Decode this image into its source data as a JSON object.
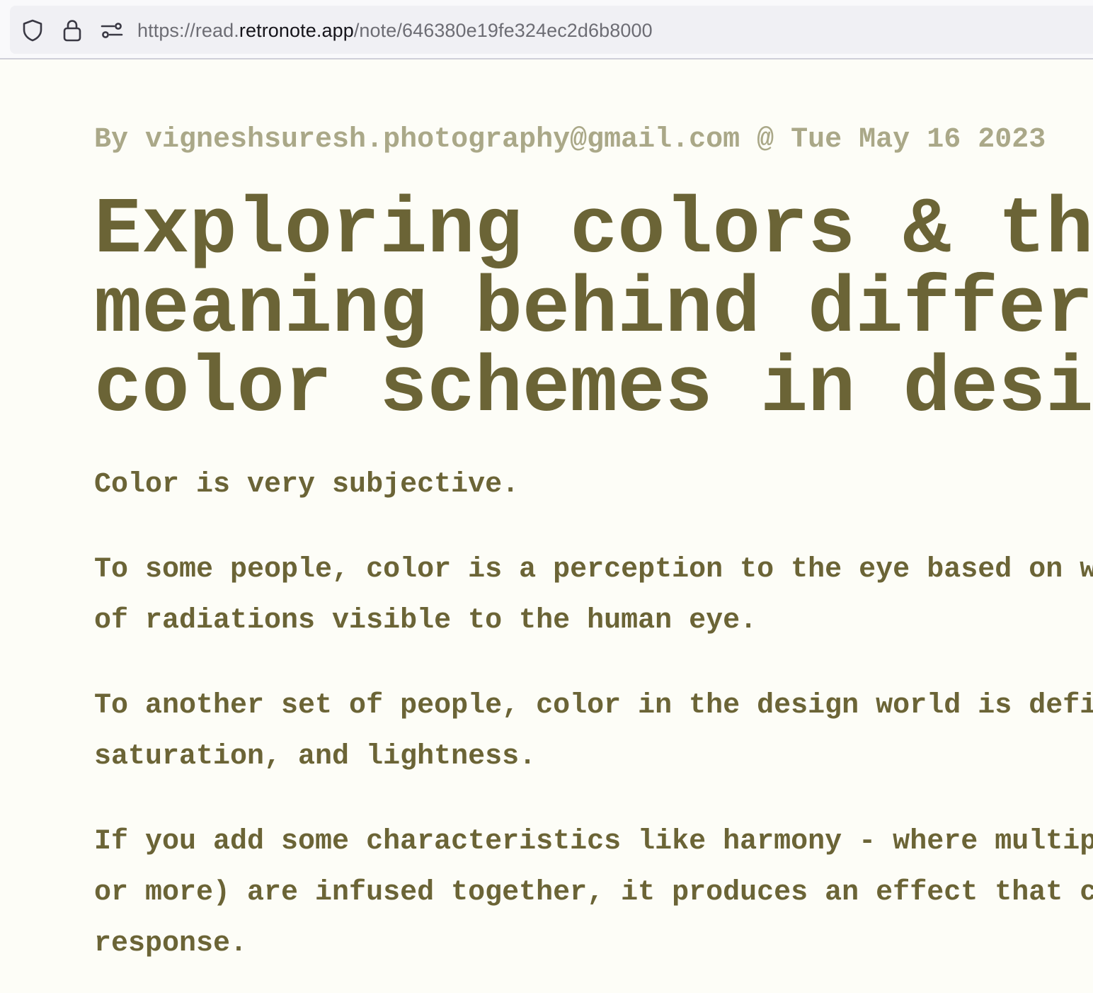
{
  "browser": {
    "url_scheme": "https://read.",
    "url_host": "retronote.app",
    "url_path": "/note/646380e19fe324ec2d6b8000",
    "icons": [
      "shield-icon",
      "lock-icon",
      "page-settings-icon"
    ]
  },
  "note": {
    "byline": "By vigneshsuresh.photography@gmail.com @ Tue May 16 2023",
    "title_lines": [
      "Exploring colors & th",
      "meaning behind differ",
      "color schemes in desi"
    ],
    "paragraphs": [
      {
        "lines": [
          "Color is very subjective."
        ]
      },
      {
        "lines": [
          "To some people, color is a perception to the eye based on w",
          "of radiations visible to the human eye."
        ]
      },
      {
        "lines": [
          "To another set of people, color in the design world is defi",
          "saturation, and lightness."
        ]
      },
      {
        "lines": [
          "If you add some characteristics like harmony - where multip",
          "or more) are infused together, it produces an effect that c",
          "response."
        ]
      }
    ]
  },
  "colors": {
    "page_background": "#fdfdf7",
    "text": "#6b6436",
    "byline": "#aaa888",
    "url_bar": "#f0f0f4"
  }
}
